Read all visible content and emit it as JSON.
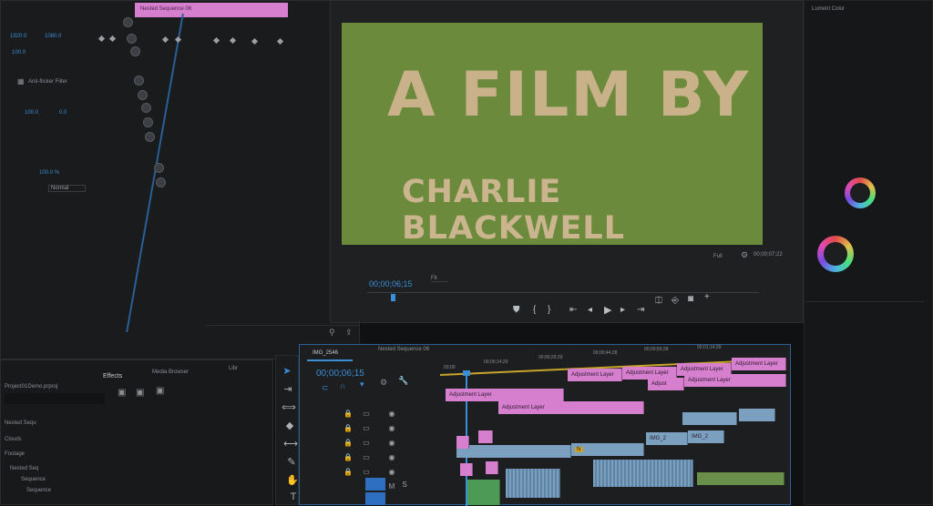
{
  "effect_controls": {
    "clip_header": "Nested Sequence 06",
    "values": [
      "1920.0",
      "1080.0",
      "100.0",
      "100.0",
      "0.0"
    ],
    "anti_flicker_label": "Anti-flicker Filter",
    "opacity_value": "100.0 %",
    "blend_mode": "Normal"
  },
  "program_monitor": {
    "title_line1": "A FILM BY",
    "title_line2": "CHARLIE BLACKWELL",
    "timecode": "00;00;06;15",
    "fit": "Fit",
    "quality": "Full",
    "duration": "00;00;07;22"
  },
  "project_panel": {
    "tabs": [
      "Effects",
      "Media Browser",
      "Libr"
    ],
    "project_file": "Project01Demo.prproj",
    "items": [
      "Nested Sequ",
      "Clouds",
      "Footage",
      "Nested Seq",
      "Sequence",
      "Sequence"
    ]
  },
  "timeline": {
    "tabs": [
      "IMG_2546",
      "Nested Sequence 06"
    ],
    "timecode": "00;00;06;15",
    "ruler": [
      "00;00",
      "00;00;14;29",
      "00;00;29;29",
      "00;00;44;28",
      "00;00;59;28",
      "00;01;14;29"
    ],
    "adjustment_clip_label": "Adjustment Layer",
    "adjustment_short": "Adjust",
    "img_clip_label": "IMG_2",
    "fx_badge": "fx"
  },
  "lumetri": {
    "header": "Lumetri Color"
  },
  "colors": {
    "accent_blue": "#2e6fc2",
    "adjustment_pink": "#d77fcf",
    "video_clip": "#7b9fbe",
    "monitor_green": "#6c8a3c"
  }
}
